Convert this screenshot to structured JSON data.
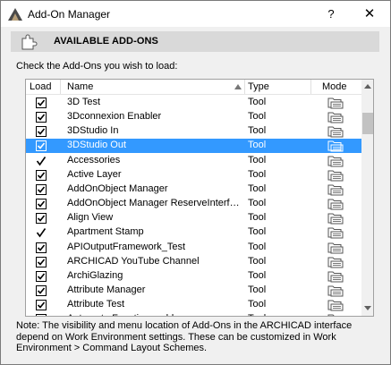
{
  "window": {
    "title": "Add-On Manager",
    "help_label": "?",
    "close_label": "✕"
  },
  "section": {
    "title": "AVAILABLE ADD-ONS",
    "icon": "puzzle-piece-icon"
  },
  "instructions": "Check the Add-Ons you wish to load:",
  "list": {
    "columns": {
      "load": "Load",
      "name": "Name",
      "type": "Type",
      "mode": "Mode"
    },
    "sort": {
      "column": "Name",
      "direction": "ascending"
    },
    "rows": [
      {
        "state": "checked",
        "name": "3D Test",
        "type": "Tool",
        "selected": false
      },
      {
        "state": "checked",
        "name": "3Dconnexion Enabler",
        "type": "Tool",
        "selected": false
      },
      {
        "state": "checked",
        "name": "3DStudio In",
        "type": "Tool",
        "selected": false
      },
      {
        "state": "checked",
        "name": "3DStudio Out",
        "type": "Tool",
        "selected": true
      },
      {
        "state": "fixed",
        "name": "Accessories",
        "type": "Tool",
        "selected": false
      },
      {
        "state": "checked",
        "name": "Active Layer",
        "type": "Tool",
        "selected": false
      },
      {
        "state": "checked",
        "name": "AddOnObject Manager",
        "type": "Tool",
        "selected": false
      },
      {
        "state": "checked",
        "name": "AddOnObject Manager ReserveInterf…",
        "type": "Tool",
        "selected": false
      },
      {
        "state": "checked",
        "name": "Align View",
        "type": "Tool",
        "selected": false
      },
      {
        "state": "fixed",
        "name": "Apartment Stamp",
        "type": "Tool",
        "selected": false
      },
      {
        "state": "checked",
        "name": "APIOutputFramework_Test",
        "type": "Tool",
        "selected": false
      },
      {
        "state": "checked",
        "name": "ARCHICAD YouTube Channel",
        "type": "Tool",
        "selected": false
      },
      {
        "state": "checked",
        "name": "ArchiGlazing",
        "type": "Tool",
        "selected": false
      },
      {
        "state": "checked",
        "name": "Attribute Manager",
        "type": "Tool",
        "selected": false
      },
      {
        "state": "checked",
        "name": "Attribute Test",
        "type": "Tool",
        "selected": false
      },
      {
        "state": "checked",
        "name": "Automate Functions add-on",
        "type": "Tool",
        "selected": false
      }
    ],
    "mode_icon": "mode-folder-icon"
  },
  "note": "Note: The visibility and menu location of Add-Ons in the ARCHICAD interface depend on Work Environment settings. These can be customized in Work Environment > Command Layout Schemes.",
  "colors": {
    "selection": "#3399ff",
    "section_bg": "#d9d9d9",
    "dialog_bg": "#f0f0f0"
  }
}
